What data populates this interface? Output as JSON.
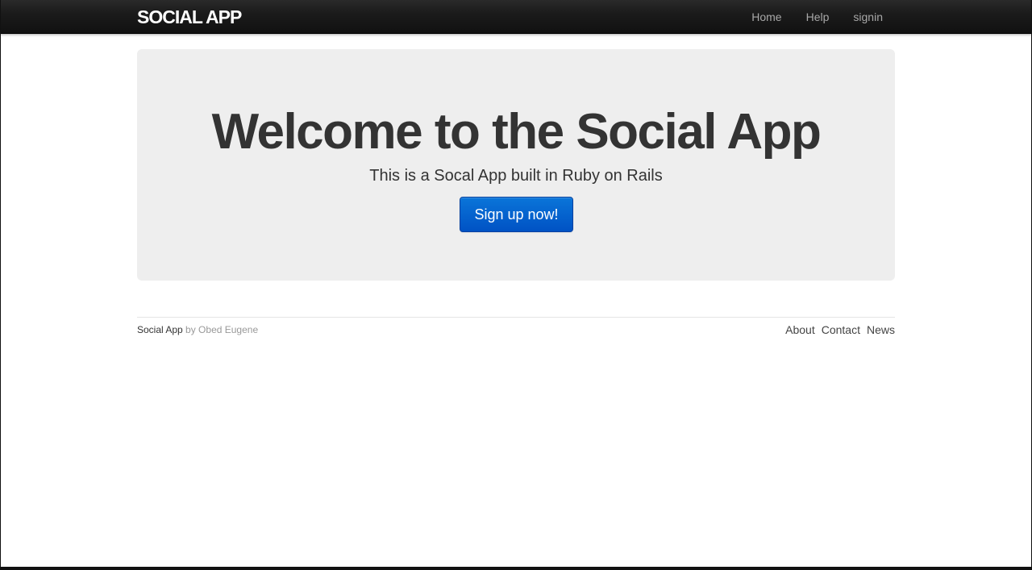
{
  "header": {
    "brand": "SOCIAL APP",
    "nav": [
      {
        "label": "Home"
      },
      {
        "label": "Help"
      },
      {
        "label": "signin"
      }
    ]
  },
  "hero": {
    "title": "Welcome to the Social App",
    "subtitle": "This is a Socal App built in Ruby on Rails",
    "cta_label": "Sign up now!"
  },
  "footer": {
    "app_name": "Social App",
    "byline": " by Obed Eugene",
    "links": [
      {
        "label": "About"
      },
      {
        "label": "Contact"
      },
      {
        "label": "News"
      }
    ]
  },
  "colors": {
    "navbar": "#1b1b1b",
    "hero_background": "#eeeeee",
    "cta_button": "#0a66d0",
    "text": "#333333"
  }
}
